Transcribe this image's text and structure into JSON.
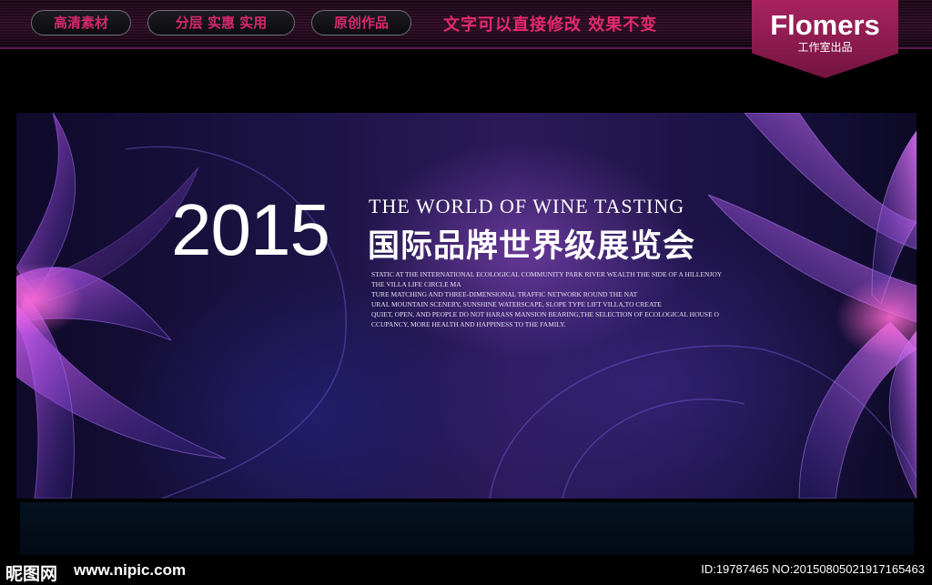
{
  "header": {
    "pills": [
      "高清素材",
      "分层 实惠 实用",
      "原创作品"
    ],
    "slogan": "文字可以直接修改  效果不变",
    "brand": {
      "name": "Flomers",
      "sub": "工作室出品"
    }
  },
  "banner": {
    "year": "2015",
    "title_en": "THE WORLD OF WINE TASTING",
    "title_cn": "国际品牌世界级展览会",
    "body_lines": [
      "STATIC AT THE INTERNATIONAL ECOLOGICAL COMMUNITY PARK RIVER WEALTH THE SIDE OF A HILLENJOY",
      "THE VILLA LIFE CIRCLE MA",
      "TURE MATCHING AND THREE-DIMENSIONAL TRAFFIC NETWORK ROUND THE NAT",
      "URAL MOUNTAIN SCENERY, SUNSHINE WATERSCAPE, SLOPE TYPE LIFT VILLA,TO CREATE",
      "QUIET, OPEN, AND PEOPLE DO NOT HARASS MANSION BEARING,THE SELECTION OF ECOLOGICAL HOUSE O",
      "CCUPANCY, MORE HEALTH AND HAPPINESS TO THE FAMILY."
    ]
  },
  "watermark": {
    "logo": "昵图网",
    "url": "www.nipic.com",
    "id": "ID:19787465 NO:20150805021917165463"
  },
  "colors": {
    "accent_pink": "#e42a6e",
    "brand_bg": "#8e1c50",
    "banner_violet": "#2b1a5a"
  }
}
